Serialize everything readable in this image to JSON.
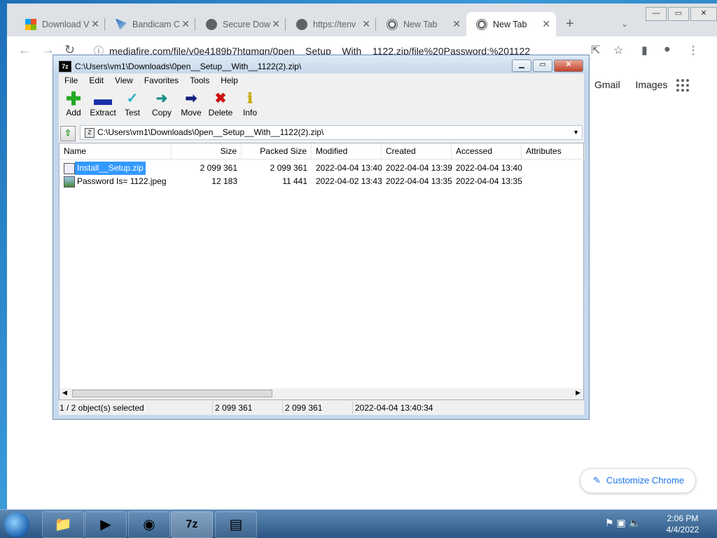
{
  "browser": {
    "tabs": [
      {
        "title": "Download V",
        "favicon": "microsoft-icon"
      },
      {
        "title": "Bandicam C",
        "favicon": "bandicam-icon"
      },
      {
        "title": "Secure Dow",
        "favicon": "globe-icon"
      },
      {
        "title": "https://tenv",
        "favicon": "globe-icon"
      },
      {
        "title": "New Tab",
        "favicon": "chrome-icon"
      },
      {
        "title": "New Tab",
        "favicon": "chrome-icon"
      }
    ],
    "url": "mediafire.com/file/v0e4189b7htqmqn/0pen__Setup__With__1122.zip/file%20Password:%201122",
    "ntp_links": [
      "Gmail",
      "Images"
    ],
    "customize_label": "Customize Chrome"
  },
  "archive_window": {
    "title": "C:\\Users\\vm1\\Downloads\\0pen__Setup__With__1122(2).zip\\",
    "menu": [
      "File",
      "Edit",
      "View",
      "Favorites",
      "Tools",
      "Help"
    ],
    "toolbar": [
      {
        "label": "Add",
        "icon": "plus-icon",
        "color": "#22aa22"
      },
      {
        "label": "Extract",
        "icon": "minus-icon",
        "color": "#1a2fa8"
      },
      {
        "label": "Test",
        "icon": "check-icon",
        "color": "#2bb0c8"
      },
      {
        "label": "Copy",
        "icon": "copy-arrow-icon",
        "color": "#1f8f88"
      },
      {
        "label": "Move",
        "icon": "move-arrow-icon",
        "color": "#14207a"
      },
      {
        "label": "Delete",
        "icon": "delete-x-icon",
        "color": "#cc1111"
      },
      {
        "label": "Info",
        "icon": "info-icon",
        "color": "#c8a800"
      }
    ],
    "address": "C:\\Users\\vm1\\Downloads\\0pen__Setup__With__1122(2).zip\\",
    "columns": [
      "Name",
      "Size",
      "Packed Size",
      "Modified",
      "Created",
      "Accessed",
      "Attributes"
    ],
    "files": [
      {
        "name": "Install__Setup.zip",
        "size": "2 099 361",
        "packed": "2 099 361",
        "modified": "2022-04-04 13:40",
        "created": "2022-04-04 13:39",
        "accessed": "2022-04-04 13:40",
        "selected": true
      },
      {
        "name": "Password Is= 1122.jpeg",
        "size": "12 183",
        "packed": "11 441",
        "modified": "2022-04-02 13:43",
        "created": "2022-04-04 13:35",
        "accessed": "2022-04-04 13:35",
        "selected": false
      }
    ],
    "status": {
      "selection": "1 / 2 object(s) selected",
      "size": "2 099 361",
      "packed": "2 099 361",
      "date": "2022-04-04 13:40:34"
    }
  },
  "taskbar": {
    "apps": [
      "explorer-icon",
      "media-player-icon",
      "chrome-icon",
      "7zip-icon",
      "notepad-icon"
    ],
    "time": "2:06 PM",
    "date": "4/4/2022"
  }
}
